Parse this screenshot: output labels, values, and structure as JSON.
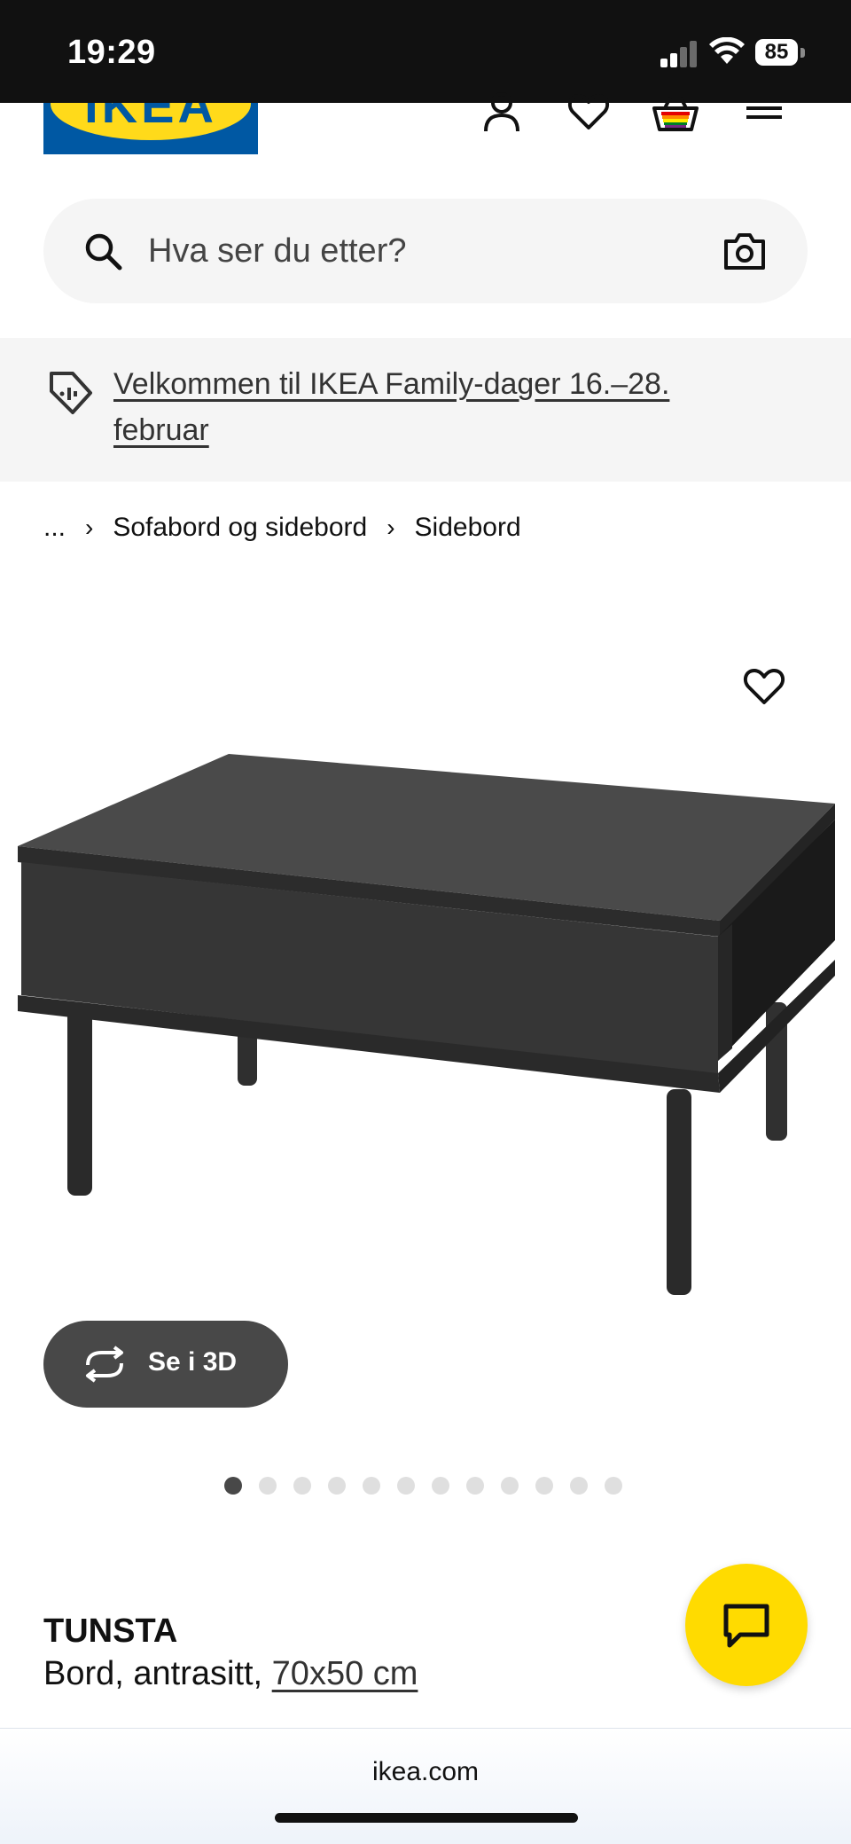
{
  "status_bar": {
    "time": "19:29",
    "battery": "85"
  },
  "header": {
    "logo_text": "IKEA",
    "icons": [
      "user-icon",
      "heart-icon",
      "basket-icon",
      "menu-icon"
    ]
  },
  "search": {
    "placeholder": "Hva ser du etter?"
  },
  "banner": {
    "text": "Velkommen til IKEA Family-dager 16.–28. februar"
  },
  "breadcrumb": {
    "ellipsis": "...",
    "items": [
      "Sofabord og sidebord",
      "Sidebord"
    ]
  },
  "product": {
    "name": "TUNSTA",
    "description_prefix": "Bord, antrasitt, ",
    "size": "70x50 cm",
    "view_3d_label": "Se i 3D",
    "image_count": 12,
    "active_image": 1
  },
  "browser": {
    "url": "ikea.com"
  },
  "colors": {
    "ikea_blue": "#0058a3",
    "ikea_yellow": "#ffda1a",
    "chat_yellow": "#ffdb00",
    "dark_button": "#484848",
    "status_bar": "#111111"
  }
}
